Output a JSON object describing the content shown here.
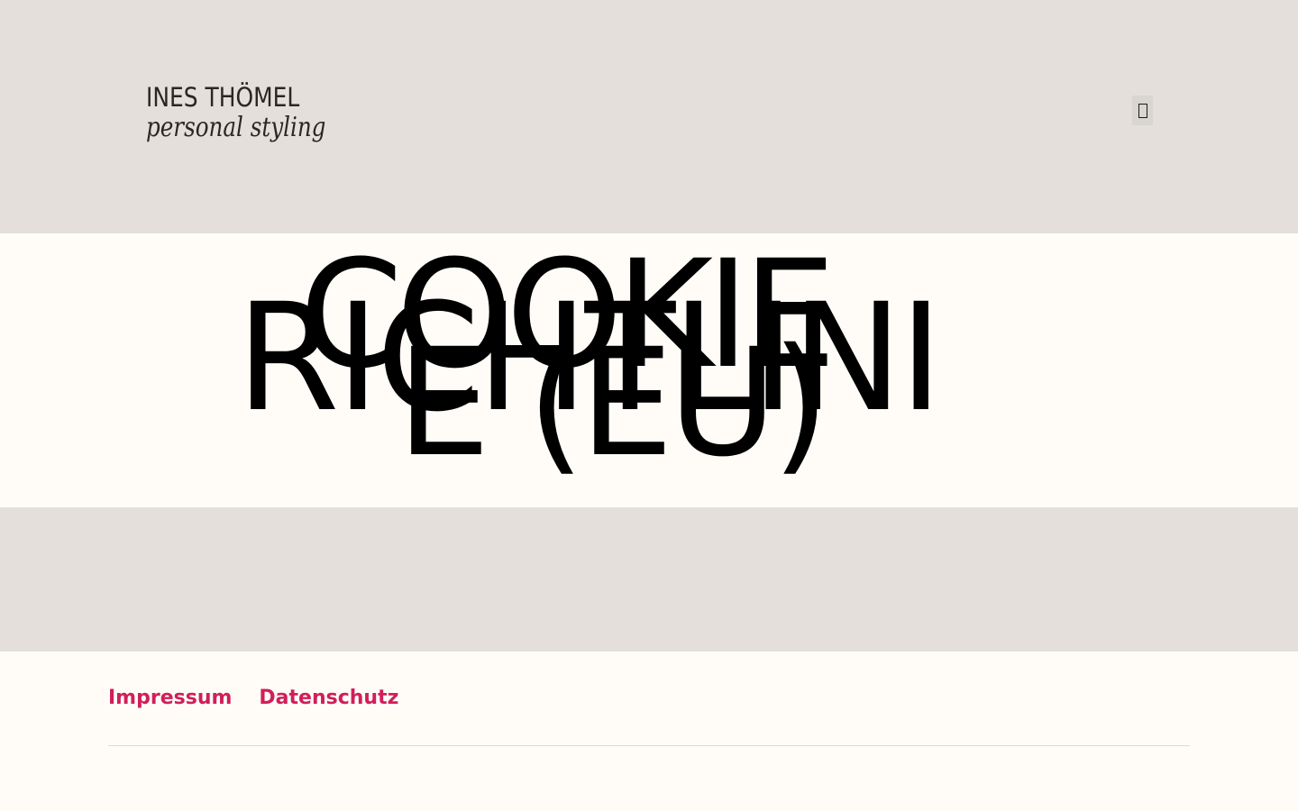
{
  "header": {
    "logo_line1": "INES THÖMEL",
    "logo_line2": "personal styling",
    "menu_icon": "menu-icon"
  },
  "hero": {
    "title_lines": [
      "COOKIE",
      "RICHTLINI",
      "E (EU)"
    ]
  },
  "footer": {
    "links": [
      "Impressum",
      "Datenschutz"
    ]
  },
  "colors": {
    "header_bg": "#e4dfdb",
    "page_bg": "#fffcf8",
    "link": "#d01f5b"
  }
}
